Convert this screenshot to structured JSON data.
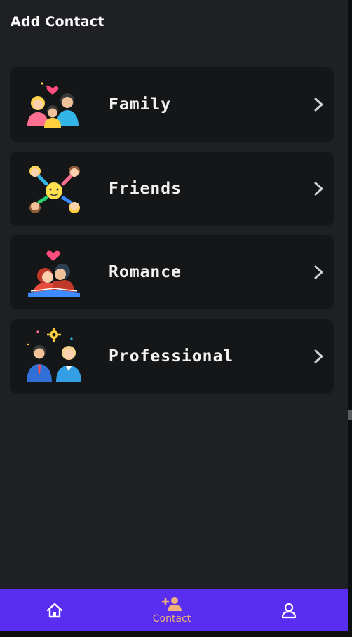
{
  "header": {
    "title": "Add Contact"
  },
  "categories": [
    {
      "label": "Family",
      "icon": "family-illustration-icon"
    },
    {
      "label": "Friends",
      "icon": "friends-illustration-icon"
    },
    {
      "label": "Romance",
      "icon": "romance-illustration-icon"
    },
    {
      "label": "Professional",
      "icon": "professional-illustration-icon"
    }
  ],
  "nav": {
    "items": [
      {
        "name": "home",
        "icon": "home-icon",
        "label": ""
      },
      {
        "name": "contact",
        "icon": "add-contact-icon",
        "label": "Contact",
        "active": true
      },
      {
        "name": "profile",
        "icon": "user-icon",
        "label": ""
      }
    ]
  },
  "colors": {
    "background": "#1e2023",
    "card": "#141618",
    "nav": "#5a2ef0",
    "nav_active": "#f0b27a",
    "text": "#ffffff"
  }
}
